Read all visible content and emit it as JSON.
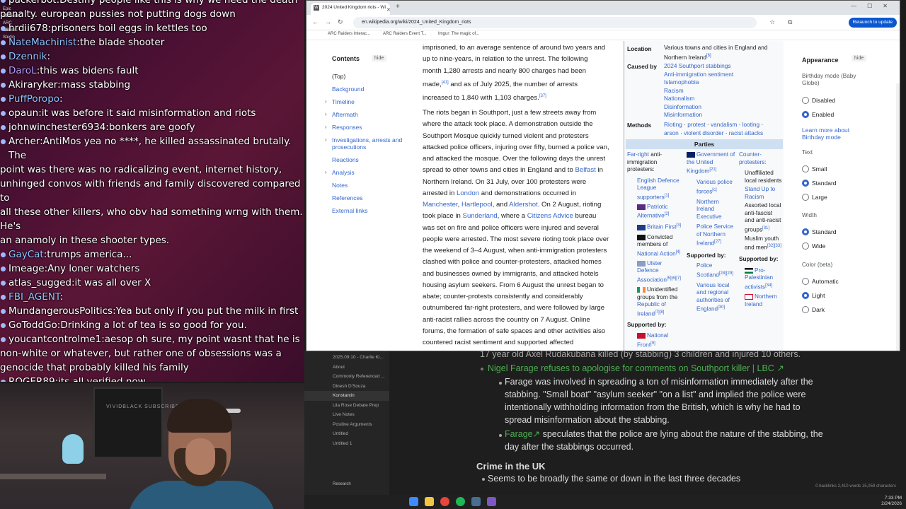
{
  "chat": {
    "lines": [
      {
        "user": "packerbot",
        "color": "#ffffff",
        "text": "Destiny people like this is why we need the death",
        "cont": "penalty. european pussies not putting dogs down"
      },
      {
        "user": "hrdii678",
        "color": "#ffffff",
        "text": "prisoners boil eggs in kettles too"
      },
      {
        "user": "NateMachinist",
        "color": "#8ec2ff",
        "text": "the blade shooter"
      },
      {
        "user": "Dzennik",
        "color": "#8ec2ff",
        "text": ""
      },
      {
        "user": "DaroL",
        "color": "#b39dff",
        "text": "this was bidens fault"
      },
      {
        "user": "Akiraryker",
        "color": "#ffffff",
        "text": "mass stabbing"
      },
      {
        "user": "PuffPoropo",
        "color": "#8ec2ff",
        "text": ""
      },
      {
        "user": "opaun",
        "color": "#ffffff",
        "text": "it was before it said misinformation and riots"
      },
      {
        "user": "johnwinchester6934",
        "color": "#ffffff",
        "text": "bonkers are goofy"
      },
      {
        "user": "Archer",
        "color": "#ffffff",
        "text": "AntiMos yea no ****, he killed assassinated brutally. The",
        "cont2": [
          "point was there was no radicalizing event, internet history,",
          "unhinged convos with friends and family discovered compared to",
          "all these other killers, who obv had something wrng with them. He's",
          "an anamoly in these shooter types."
        ]
      },
      {
        "user": "GayCat",
        "color": "#8ec2ff",
        "text": "trumps america..."
      },
      {
        "user": "Imeage",
        "color": "#ffffff",
        "text": "Any loner watchers"
      },
      {
        "user": "atlas_sugged",
        "color": "#ffffff",
        "text": "it was all over X"
      },
      {
        "user": "FBI_AGENT",
        "color": "#8ec2ff",
        "text": ""
      },
      {
        "user": "MundangerousPolitics",
        "color": "#ffffff",
        "text": "Yea but only if you put the milk in first"
      },
      {
        "user": "GoToddGo",
        "color": "#ffffff",
        "text": "Drinking a lot of tea is so good for you."
      },
      {
        "user": "youcantcontrolme1",
        "color": "#ffffff",
        "text": "aesop oh sure, my point wasnt that he is",
        "cont2": [
          "non-white or whatever, but rather one of obsessions was a",
          "genocide that probably killed his family"
        ]
      },
      {
        "user": "ROGER89",
        "color": "#ffffff",
        "text": "its all verified now"
      }
    ],
    "desktop_icons": [
      "Epic Games",
      "Launcher",
      "ARC Raiders",
      "OBS Studio"
    ]
  },
  "webcam": {
    "monitor_text": "VIVIDBLACK SUBSCRIBE"
  },
  "browser": {
    "tab_title": "2024 United Kingdom riots - Wi",
    "tab_icon": "W",
    "url": "en.wikipedia.org/wiki/2024_United_Kingdom_riots",
    "relaunch": "Relaunch to update",
    "bookmarks": [
      "ARC Raiders Interac...",
      "ARC Raiders Event T...",
      "Imgur: The magic of..."
    ],
    "toc": {
      "title": "Contents",
      "hide": "hide",
      "items": [
        "(Top)",
        "Background",
        "Timeline",
        "Aftermath",
        "Responses",
        "Investigations, arrests and",
        "prosecutions",
        "Reactions",
        "Analysis",
        "Notes",
        "References",
        "External links"
      ]
    },
    "article": {
      "p1": [
        "imprisoned, to an average sentence of around two years and",
        "up to nine-years, in relation to the unrest. The following",
        "month 1,280 arrests and nearly 800 charges had been",
        "made,",
        "and as of July 2025, the number of arrests",
        "increased to 1,840 with 1,103 charges."
      ],
      "p1_refs": [
        "[41]",
        "[37]"
      ],
      "p2": [
        "The riots began in Southport, just a few streets away from",
        "where the attack took place. A demonstration outside the",
        "Southport Mosque quickly turned violent and protesters",
        "attacked police officers, injuring over fifty, burned a police van,",
        "and attacked the mosque. Over the following days the unrest",
        "spread to other towns and cities in England and to",
        "Northern Ireland. On 31 July, over 100 protesters were",
        "arrested in",
        "and demonstrations occurred in",
        ", and",
        ". On 2 August, rioting",
        "took place in",
        ", where a",
        "bureau",
        "was set on fire and police officers were injured and several",
        "people were arrested. The most severe rioting took place over",
        "the weekend of 3–4 August, when anti-immigration protesters",
        "clashed with police and counter-protesters, attacked homes",
        "and businesses owned by immigrants, and attacked hotels",
        "housing asylum seekers. From 6 August the unrest began to",
        "abate; counter-protests consistently and considerably",
        "outnumbered far-right protesters, and were followed by large",
        "anti-racist rallies across the country on 7 August. Online",
        "forums, the formation of safe spaces and other activities also",
        "countered racist sentiment and supported affected"
      ],
      "links": {
        "belfast": "Belfast",
        "london": "London",
        "manchester": "Manchester",
        "hartlepool": "Hartlepool",
        "aldershot": "Aldershot",
        "sunderland": "Sunderland",
        "citizens": "Citizens Advice"
      }
    },
    "infobox": {
      "location_label": "Location",
      "location_value": "Various towns and cities in England and Northern Ireland",
      "location_ref": "[6]",
      "caused_label": "Caused by",
      "causes": [
        "2024 Southport stabbings",
        "Anti-immigration sentiment",
        "Islamophobia",
        "Racism",
        "Nationalism",
        "Disinformation",
        "Misinformation"
      ],
      "methods_label": "Methods",
      "methods": [
        "Rioting",
        "protest",
        "vandalism",
        "looting",
        "arson",
        "violent disorder",
        "racist attacks"
      ],
      "parties_label": "Parties",
      "col1": {
        "head": "Far-right",
        "head2": "anti-immigration protesters:",
        "items": [
          "English Defence League",
          "supporters",
          "Patriotic Alternative",
          "Britain First",
          "Convicted members of",
          "National Action",
          "Ulster Defence Association",
          "Unidentified groups from the",
          "Republic of Ireland"
        ],
        "refs": [
          "[1]",
          "[2]",
          "[3]",
          "[4]",
          "[5][6][7]",
          "[7][8]"
        ],
        "supported_by": "Supported by:",
        "supporters": [
          "National Front"
        ],
        "supporters_ref": "[9]"
      },
      "col2": {
        "head": "Government of the United Kingdom",
        "head_ref": "[21]",
        "items": [
          "Various police forces",
          "Northern Ireland Executive",
          "Police Service of Northern Ireland"
        ],
        "refs": [
          "[c]",
          "[27]"
        ],
        "supported_by": "Supported by:",
        "supporters": [
          "Police Scotland",
          "Various local and regional authorities of England"
        ],
        "supporters_refs": [
          "[28][29]",
          "[30]"
        ]
      },
      "col3": {
        "head": "Counter-protesters:",
        "items": [
          "Unaffiliated local residents",
          "Stand Up to Racism",
          "Assorted local anti-fascist and anti-racist groups",
          "Muslim youth and men"
        ],
        "refs": [
          "[31]",
          "[32][33]"
        ],
        "supported_by": "Supported by:",
        "supporters": [
          "Pro-Palestinian activists",
          "Northern Ireland"
        ],
        "supporters_ref": "[34]"
      }
    },
    "appearance": {
      "title": "Appearance",
      "hide": "hide",
      "birthday_label": "Birthday mode (Baby Globe)",
      "birthday_options": [
        "Disabled",
        "Enabled"
      ],
      "birthday_selected": "Enabled",
      "learn_more": "Learn more about Birthday mode",
      "text_label": "Text",
      "text_options": [
        "Small",
        "Standard",
        "Large"
      ],
      "text_selected": "Standard",
      "width_label": "Width",
      "width_options": [
        "Standard",
        "Wide"
      ],
      "width_selected": "Standard",
      "color_label": "Color (beta)",
      "color_options": [
        "Automatic",
        "Light",
        "Dark"
      ],
      "color_selected": "Light"
    }
  },
  "notes": {
    "sidebar": [
      "2025.09.10 - Charlie Ki...",
      "About",
      "Commonly Referenced ...",
      "Dinesh D'Souza",
      "Konstantin",
      "Lila Rose Debate Prep",
      "Live Notes",
      "Positive Arguments",
      "Untitled",
      "Untitled 1"
    ],
    "sidebar_active": "Konstantin",
    "search_label": "Research",
    "lines": {
      "top": "17 year old Axel Rudakubana killed (by stabbing) 3 children and injured 10 others.",
      "link1": "Nigel Farage refuses to apologise for comments on Southport killer | LBC",
      "sub1": [
        "Farage was involved in spreading a ton of misinformation immediately after the",
        "stabbing. \"Small boat\" \"asylum seeker\" \"on a list\" and implied the police were",
        "intentionally withholding information from the British, which is why he had to",
        "spread misinformation about the stabbing."
      ],
      "link2": "Farage",
      "sub2": [
        "speculates that the police are lying about the nature of the stabbing, the",
        "day after the stabbings occurred."
      ],
      "heading": "Crime in the UK",
      "bullet": "Seems to be broadly the same or down in the last three decades"
    },
    "status": "0 backlinks   2,410 words   15,059 characters"
  },
  "taskbar": {
    "time": "7:33 PM",
    "date": "2/24/2026",
    "icons": [
      "windows-start",
      "file-explorer",
      "chrome",
      "spotify",
      "steam",
      "obsidian"
    ]
  }
}
